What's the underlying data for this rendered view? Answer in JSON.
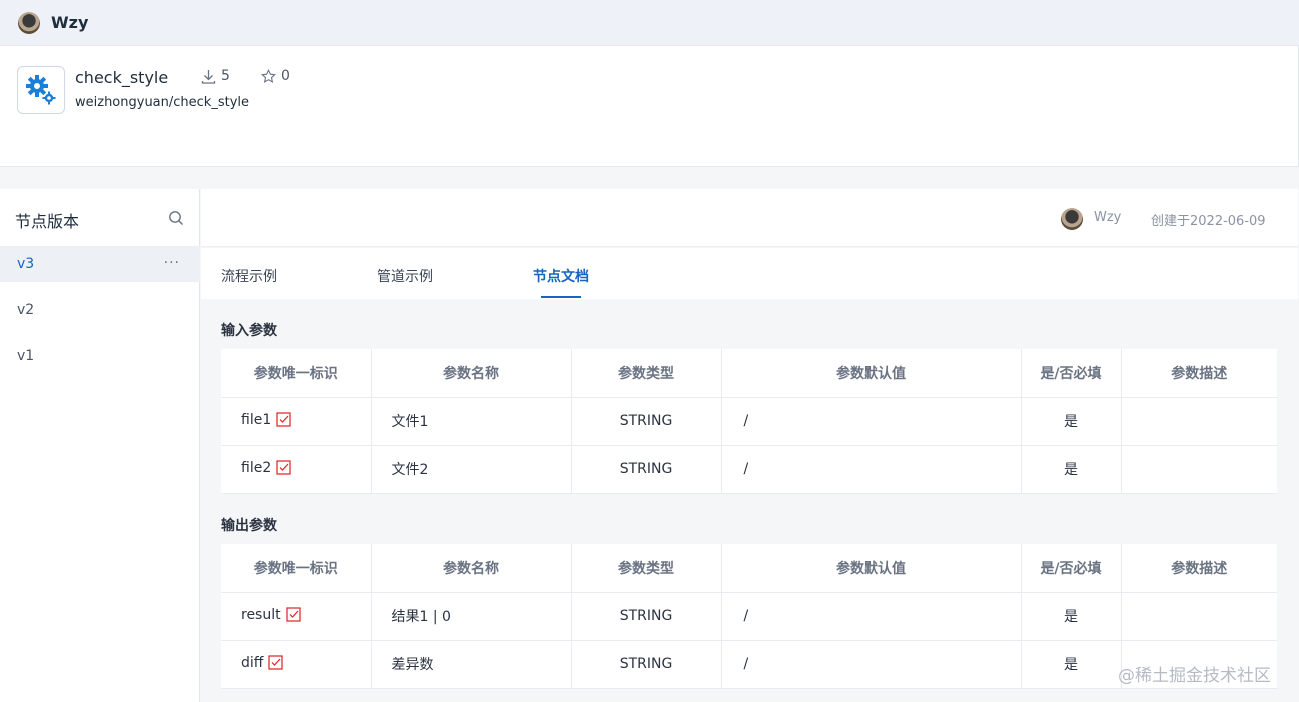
{
  "topbar": {
    "username": "Wzy"
  },
  "plugin": {
    "name": "check_style",
    "path": "weizhongyuan/check_style",
    "downloads": "5",
    "stars": "0",
    "icon": "gears-icon"
  },
  "versions_panel": {
    "title": "节点版本",
    "items": [
      {
        "label": "v3",
        "active": true
      },
      {
        "label": "v2",
        "active": false
      },
      {
        "label": "v1",
        "active": false
      }
    ],
    "more_label": "···"
  },
  "meta": {
    "user": "Wzy",
    "created": "创建于2022-06-09"
  },
  "tabs": [
    {
      "label": "流程示例",
      "active": false
    },
    {
      "label": "管道示例",
      "active": false
    },
    {
      "label": "节点文档",
      "active": true
    }
  ],
  "inputs": {
    "title": "输入参数",
    "headers": [
      "参数唯一标识",
      "参数名称",
      "参数类型",
      "参数默认值",
      "是/否必填",
      "参数描述"
    ],
    "rows": [
      {
        "id": "file1",
        "name": "文件1",
        "type": "STRING",
        "default": "/",
        "required": "是",
        "desc": ""
      },
      {
        "id": "file2",
        "name": "文件2",
        "type": "STRING",
        "default": "/",
        "required": "是",
        "desc": ""
      }
    ]
  },
  "outputs": {
    "title": "输出参数",
    "headers": [
      "参数唯一标识",
      "参数名称",
      "参数类型",
      "参数默认值",
      "是/否必填",
      "参数描述"
    ],
    "rows": [
      {
        "id": "result",
        "name": "结果1 | 0",
        "type": "STRING",
        "default": "/",
        "required": "是",
        "desc": ""
      },
      {
        "id": "diff",
        "name": "差异数",
        "type": "STRING",
        "default": "/",
        "required": "是",
        "desc": ""
      }
    ]
  },
  "watermark": "@稀土掘金技术社区",
  "colors": {
    "accent": "#1565c0",
    "required": "#e02020",
    "topbar_bg": "#eef1f8"
  }
}
